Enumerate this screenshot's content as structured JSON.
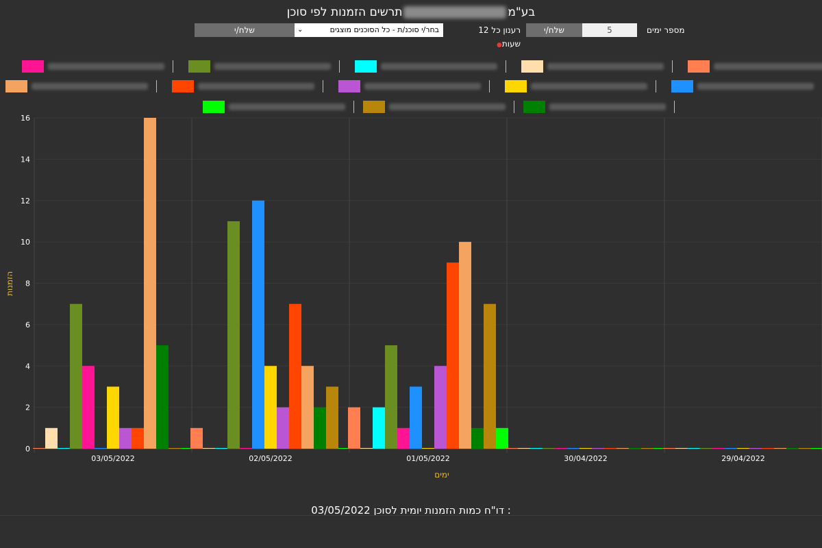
{
  "page": {
    "title_prefix": "תרשים הזמנות לפי סוכן",
    "title_suffix": "בע\"מ",
    "footer_prefix": "דו\"ח כמות הזמנות יומית לסוכן :",
    "footer_date": "03/05/2022"
  },
  "controls": {
    "days_label": "מספר ימים",
    "days_value": "5",
    "send_label": "שלח/י",
    "refresh_label": "רענון כל 12 שעות",
    "agent_select_value": "בחר/י סוכנ/ת - כל הסוכנים מוצגים",
    "send_label_2": "שלח/י"
  },
  "chart_data": {
    "type": "bar",
    "title": "",
    "xlabel": "ימים",
    "ylabel": "הזמנות",
    "ylim": [
      0,
      16
    ],
    "yticks": [
      0,
      2,
      4,
      6,
      8,
      10,
      12,
      14,
      16
    ],
    "grid": true,
    "legend_position": "top",
    "categories": [
      "03/05/2022",
      "02/05/2022",
      "01/05/2022",
      "30/04/2022",
      "29/04/2022"
    ],
    "series": [
      {
        "name": "",
        "color": "#ff7f50",
        "values": [
          0,
          1,
          2,
          0,
          0
        ]
      },
      {
        "name": "",
        "color": "#ffdead",
        "values": [
          1,
          0,
          0,
          0,
          0
        ]
      },
      {
        "name": "",
        "color": "#00ffff",
        "values": [
          0,
          0,
          2,
          0,
          0
        ]
      },
      {
        "name": "",
        "color": "#6b8e23",
        "values": [
          7,
          11,
          5,
          0,
          0
        ]
      },
      {
        "name": "",
        "color": "#ff1493",
        "values": [
          4,
          0,
          1,
          0,
          0
        ]
      },
      {
        "name": "",
        "color": "#1e90ff",
        "values": [
          0,
          12,
          3,
          0,
          0
        ]
      },
      {
        "name": "",
        "color": "#ffd700",
        "values": [
          3,
          4,
          0,
          0,
          0
        ]
      },
      {
        "name": "",
        "color": "#ba55d3",
        "values": [
          1,
          2,
          4,
          0,
          0
        ]
      },
      {
        "name": "",
        "color": "#ff4500",
        "values": [
          1,
          7,
          9,
          0,
          0
        ]
      },
      {
        "name": "",
        "color": "#f4a460",
        "values": [
          16,
          4,
          10,
          0,
          0
        ]
      },
      {
        "name": "",
        "color": "#008000",
        "values": [
          5,
          2,
          1,
          0,
          0
        ]
      },
      {
        "name": "",
        "color": "#b8860b",
        "values": [
          0,
          3,
          7,
          0,
          0
        ]
      },
      {
        "name": "",
        "color": "#00ff00",
        "values": [
          0,
          0,
          1,
          0,
          0
        ]
      }
    ]
  }
}
